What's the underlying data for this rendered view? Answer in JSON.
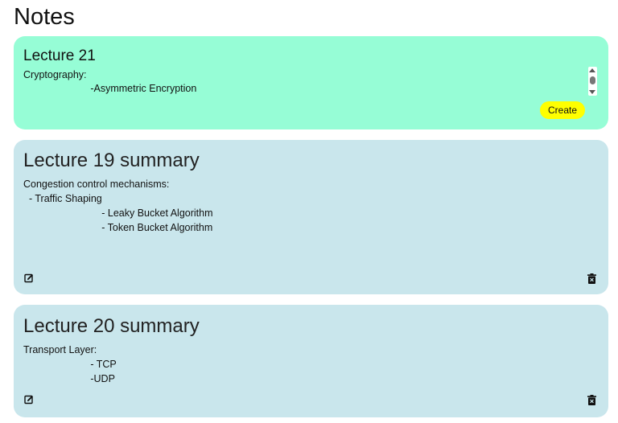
{
  "page": {
    "title": "Notes"
  },
  "create_note": {
    "title_value": "Lecture 21",
    "body_value": "Cryptography:\n                        -Asymmetric Encryption",
    "create_label": "Create",
    "colors": {
      "background": "#96fdd6",
      "button": "#ffff00"
    }
  },
  "notes": [
    {
      "title": "Lecture 19 summary",
      "body": "Congestion control mechanisms:\n  - Traffic Shaping\n                            - Leaky Bucket Algorithm\n                            - Token Bucket Algorithm",
      "edit_icon": "edit-icon",
      "delete_icon": "trash-icon"
    },
    {
      "title": "Lecture 20 summary",
      "body": "Transport Layer:\n                        - TCP\n                        -UDP",
      "edit_icon": "edit-icon",
      "delete_icon": "trash-icon"
    }
  ],
  "colors": {
    "note_card": "#c9e6ec"
  }
}
